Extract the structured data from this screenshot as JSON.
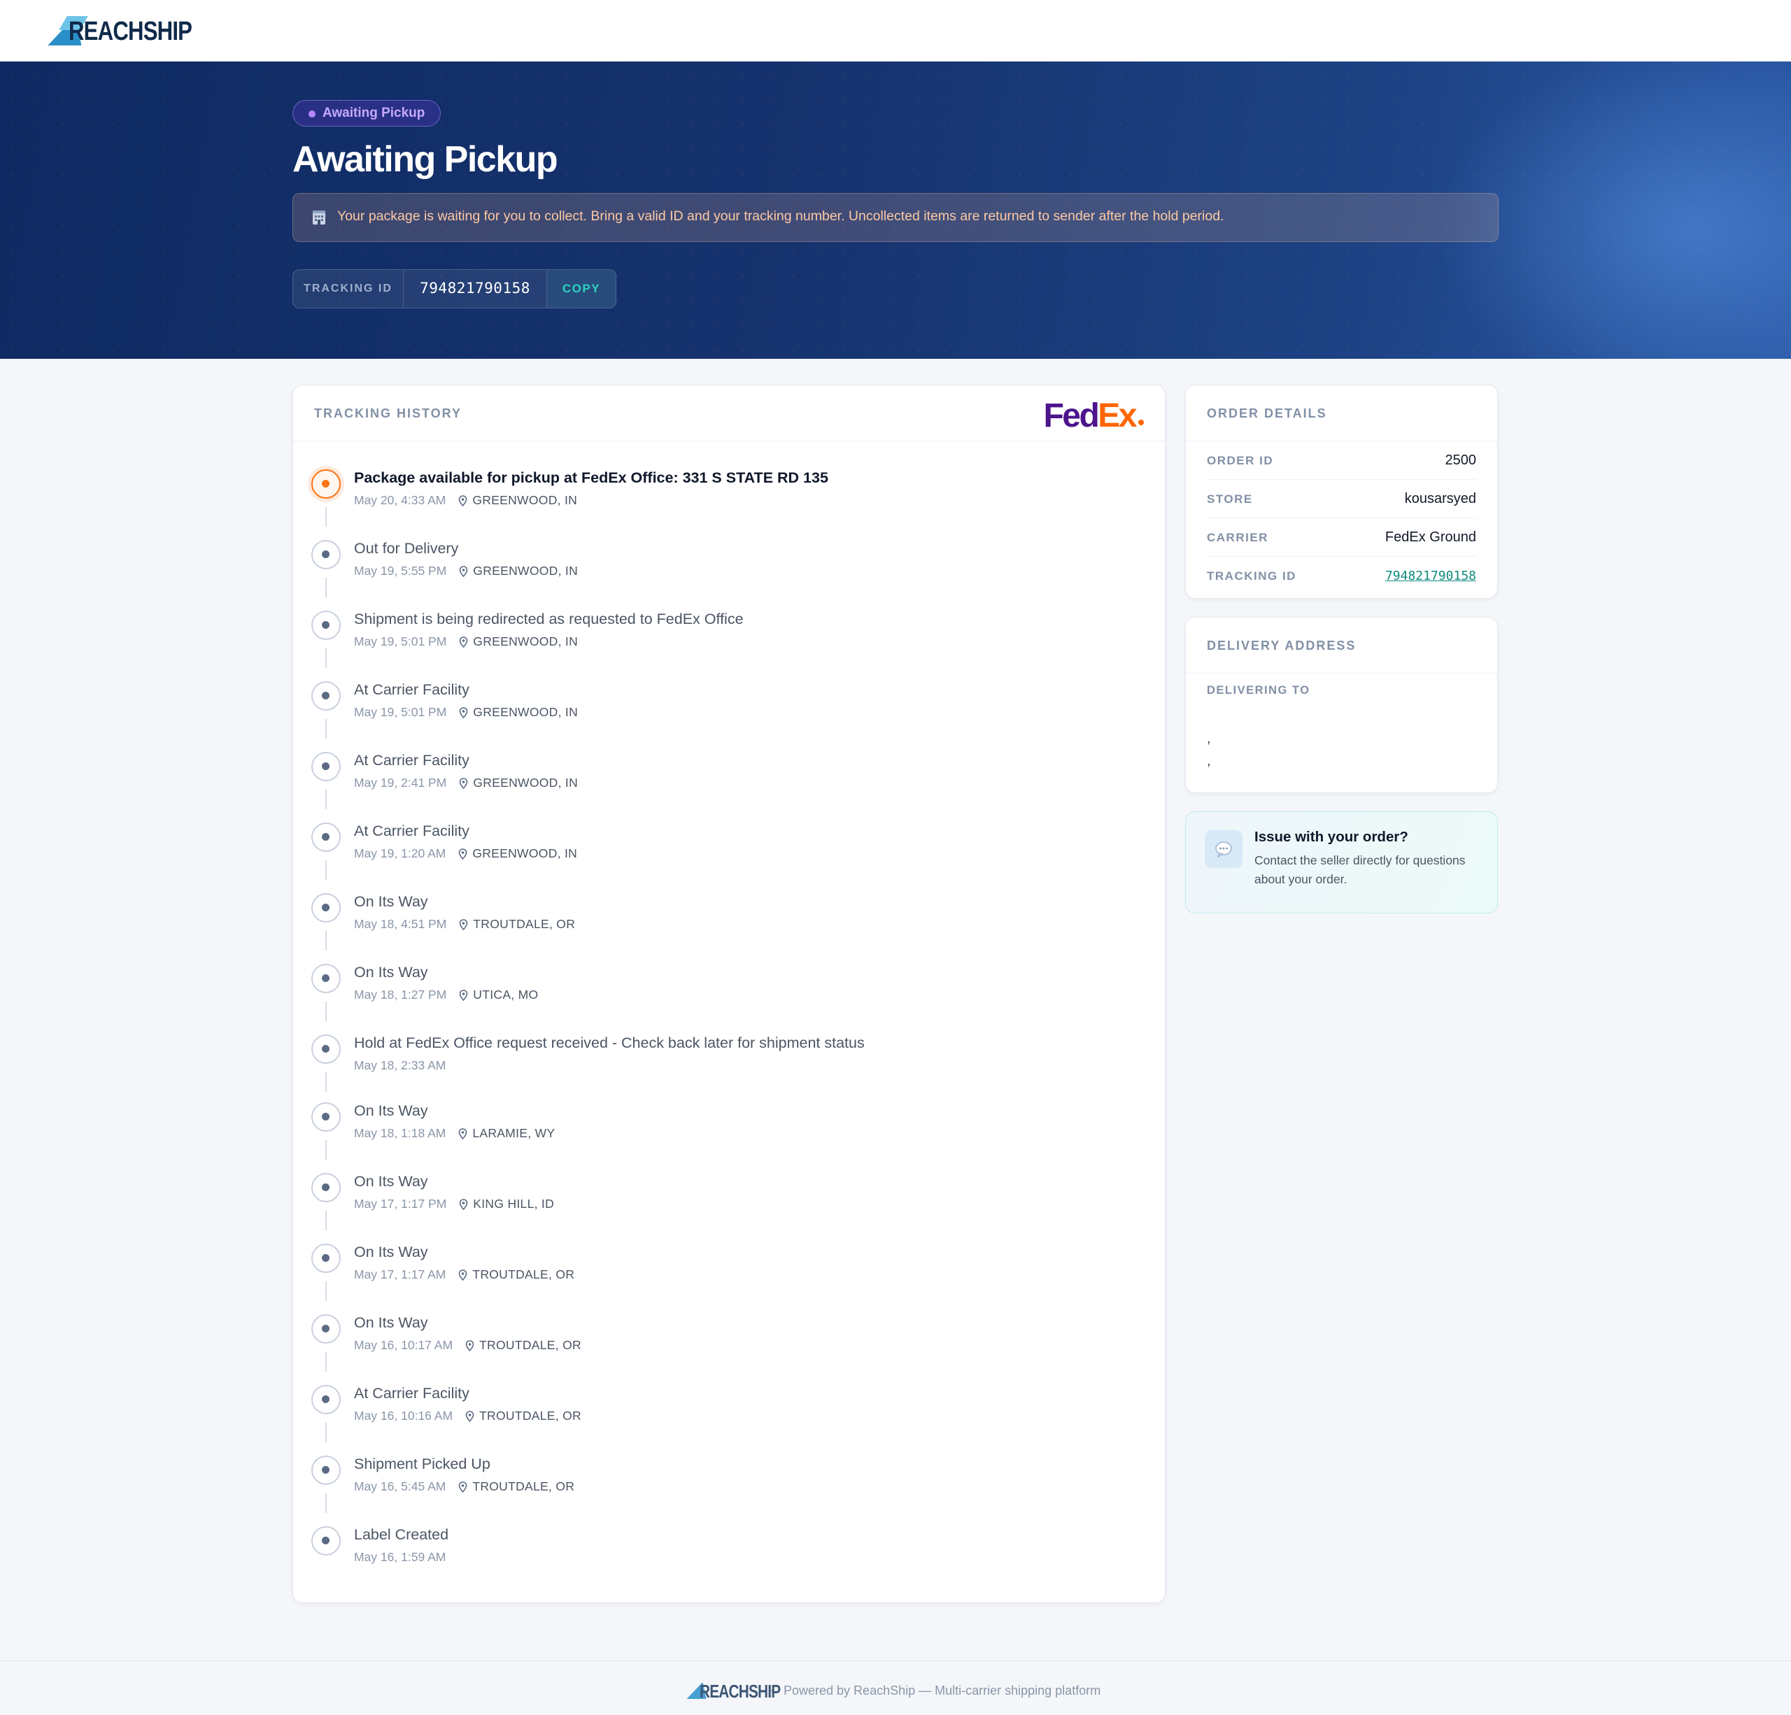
{
  "brand": {
    "name": "REACHSHIP",
    "footer_text": "Powered by ReachShip — Multi-carrier shipping platform"
  },
  "hero": {
    "status_badge": "Awaiting Pickup",
    "title": "Awaiting Pickup",
    "notice": "Your package is waiting for you to collect. Bring a valid ID and your tracking number. Uncollected items are returned to sender after the hold period.",
    "tracking_label": "TRACKING ID",
    "tracking_number": "794821790158",
    "copy_label": "COPY"
  },
  "history": {
    "heading": "TRACKING HISTORY",
    "carrier_logo": {
      "fed": "Fed",
      "ex": "Ex"
    },
    "events": [
      {
        "title": "Package available for pickup at FedEx Office: 331 S STATE RD 135",
        "time": "May 20, 4:33 AM",
        "location": "GREENWOOD, IN",
        "current": true
      },
      {
        "title": "Out for Delivery",
        "time": "May 19, 5:55 PM",
        "location": "GREENWOOD, IN"
      },
      {
        "title": "Shipment is being redirected as requested to FedEx Office",
        "time": "May 19, 5:01 PM",
        "location": "GREENWOOD, IN"
      },
      {
        "title": "At Carrier Facility",
        "time": "May 19, 5:01 PM",
        "location": "GREENWOOD, IN"
      },
      {
        "title": "At Carrier Facility",
        "time": "May 19, 2:41 PM",
        "location": "GREENWOOD, IN"
      },
      {
        "title": "At Carrier Facility",
        "time": "May 19, 1:20 AM",
        "location": "GREENWOOD, IN"
      },
      {
        "title": "On Its Way",
        "time": "May 18, 4:51 PM",
        "location": "TROUTDALE, OR"
      },
      {
        "title": "On Its Way",
        "time": "May 18, 1:27 PM",
        "location": "UTICA, MO"
      },
      {
        "title": "Hold at FedEx Office request received - Check back later for shipment status",
        "time": "May 18, 2:33 AM",
        "location": ""
      },
      {
        "title": "On Its Way",
        "time": "May 18, 1:18 AM",
        "location": "LARAMIE, WY"
      },
      {
        "title": "On Its Way",
        "time": "May 17, 1:17 PM",
        "location": "KING HILL, ID"
      },
      {
        "title": "On Its Way",
        "time": "May 17, 1:17 AM",
        "location": "TROUTDALE, OR"
      },
      {
        "title": "On Its Way",
        "time": "May 16, 10:17 AM",
        "location": "TROUTDALE, OR"
      },
      {
        "title": "At Carrier Facility",
        "time": "May 16, 10:16 AM",
        "location": "TROUTDALE, OR"
      },
      {
        "title": "Shipment Picked Up",
        "time": "May 16, 5:45 AM",
        "location": "TROUTDALE, OR"
      },
      {
        "title": "Label Created",
        "time": "May 16, 1:59 AM",
        "location": ""
      }
    ]
  },
  "order_details": {
    "heading": "ORDER DETAILS",
    "rows": [
      {
        "key": "ORDER ID",
        "value": "2500"
      },
      {
        "key": "STORE",
        "value": "kousarsyed"
      },
      {
        "key": "CARRIER",
        "value": "FedEx Ground"
      },
      {
        "key": "TRACKING ID",
        "value": "794821790158",
        "link": true
      }
    ]
  },
  "delivery_address": {
    "heading": "DELIVERY ADDRESS",
    "subheading": "DELIVERING TO",
    "line1": ",",
    "line2": ","
  },
  "issue": {
    "title": "Issue with your order?",
    "body": "Contact the seller directly for questions about your order."
  },
  "colors": {
    "accent_teal": "#2dd4bf",
    "status_purple": "#b388ff",
    "current_orange": "#f97316",
    "hero_navy": "#0f2a62"
  }
}
